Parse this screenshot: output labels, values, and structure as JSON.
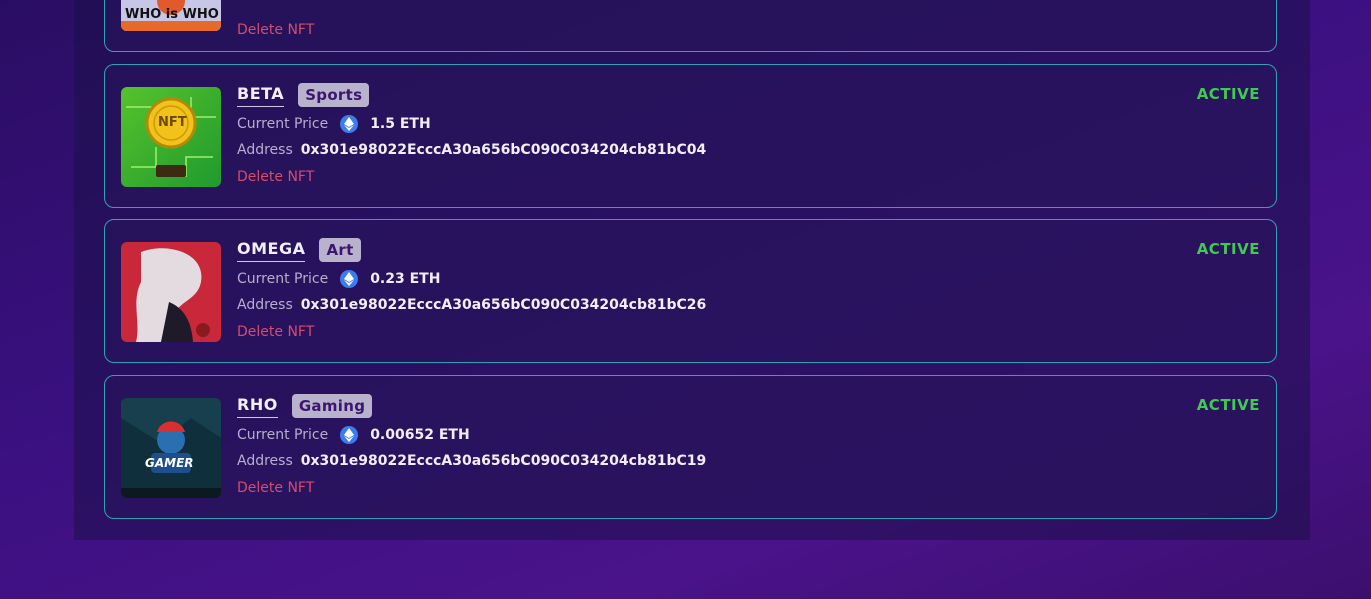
{
  "labels": {
    "current_price": "Current Price",
    "address": "Address",
    "delete": "Delete NFT"
  },
  "top_card": {
    "thumb_text": "WHO is WHO",
    "delete": "Delete NFT"
  },
  "nfts": [
    {
      "name": "BETA",
      "category": "Sports",
      "price": "1.5 ETH",
      "address": "0x301e98022EcccA30a656bC090C034204cb81bC04",
      "status": "ACTIVE",
      "thumb_icon": "nft-coin-icon",
      "thumb_text": "NFT"
    },
    {
      "name": "OMEGA",
      "category": "Art",
      "price": "0.23 ETH",
      "address": "0x301e98022EcccA30a656bC090C034204cb81bC26",
      "status": "ACTIVE",
      "thumb_icon": "anime-art-icon"
    },
    {
      "name": "RHO",
      "category": "Gaming",
      "price": "0.00652 ETH",
      "address": "0x301e98022EcccA30a656bC090C034204cb81bC19",
      "status": "ACTIVE",
      "thumb_icon": "gamer-mascot-icon",
      "thumb_text": "GAMER"
    }
  ],
  "colors": {
    "border": "#2fa3b6",
    "status_active": "#3ecb4f",
    "delete": "#d74b6b",
    "badge_bg": "#b9b2cc",
    "eth_blue": "#3c7bf0"
  }
}
